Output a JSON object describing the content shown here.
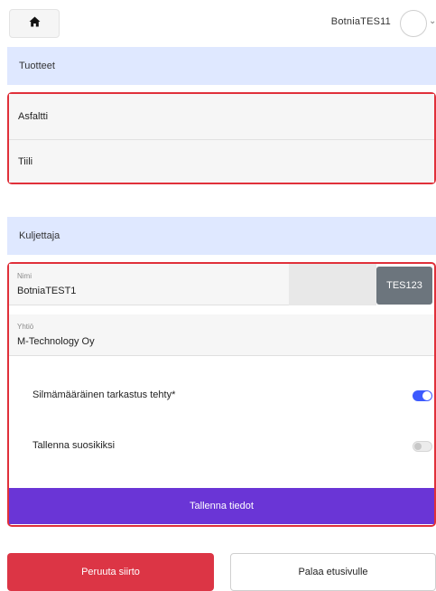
{
  "header": {
    "home_icon": "home-icon",
    "user_name": "BotniaTES11",
    "avatar": "avatar",
    "menu_icon": "chevron-down-icon"
  },
  "products": {
    "title": "Tuotteet",
    "items": [
      {
        "label": "Asfaltti"
      },
      {
        "label": "Tiili"
      }
    ]
  },
  "driver": {
    "title": "Kuljettaja",
    "name_label": "Nimi",
    "name_value": "BotniaTEST1",
    "id_button": "TES123",
    "company_label": "Yhtiö",
    "company_value": "M-Technology Oy",
    "inspection_label": "Silmämääräinen tarkastus tehty*",
    "inspection_checked": true,
    "favourite_label": "Tallenna suosikiksi",
    "favourite_checked": false,
    "save_button": "Tallenna tiedot"
  },
  "actions": {
    "cancel_button": "Peruuta siirto",
    "back_button": "Palaa etusivulle"
  },
  "colors": {
    "header_bg": "#dfe8ff",
    "frame": "#e0303a",
    "primary": "#6a35d6",
    "danger": "#dc3545",
    "toggle_on": "#3d5afe",
    "secondary": "#6c757d"
  }
}
